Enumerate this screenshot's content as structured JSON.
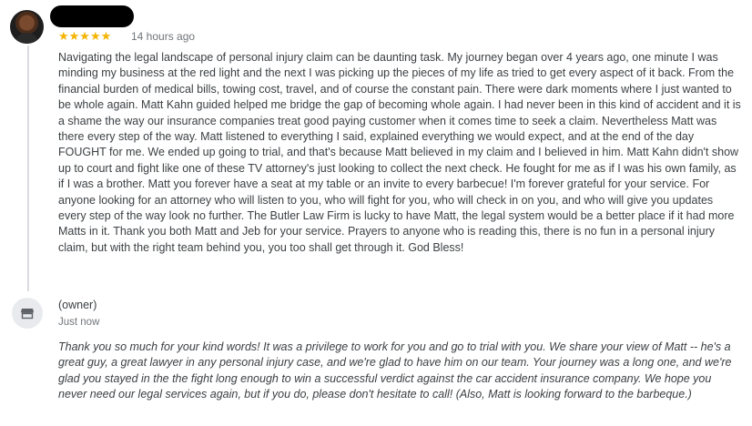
{
  "review": {
    "rating_stars": "★★★★★",
    "time": "14 hours ago",
    "text": "Navigating the legal landscape of personal injury claim can be daunting task. My journey began over 4 years ago, one minute I was minding my business at the red light and the next I was picking up the pieces of my life as tried to get every aspect of it back. From the financial burden of medical bills, towing cost, travel, and of course the constant pain. There were dark moments where I just wanted to be whole again. Matt Kahn guided helped me bridge the gap of becoming whole again. I had never been in this kind of accident and it is a shame the way our insurance companies treat good paying customer when it comes time to seek a claim. Nevertheless Matt was there every step of the way. Matt listened to everything I said, explained everything we would expect, and at the end of the day FOUGHT for me. We ended up going to trial, and that's because Matt believed in my claim and I believed in him. Matt Kahn didn't show up to court and fight like one of these TV attorney's just looking to collect the next check. He fought for me as if I was his own family, as if I was a brother. Matt you forever have a seat at my table or an invite to every barbecue! I'm forever grateful for your service. For anyone looking for an attorney who will listen to you, who will fight for you, who will check in on you, and who will give you updates every step of the way look no further. The Butler Law Firm is lucky to have Matt, the legal system would be a better place if it had more Matts in it. Thank you both Matt and Jeb for your service. Prayers to anyone who is reading this, there is no fun in a personal injury claim, but with the right team behind you, you too shall get through it. God Bless!"
  },
  "owner": {
    "label": "(owner)",
    "time": "Just now",
    "icon": "storefront-icon",
    "reply": "Thank you so much for your kind words! It was a privilege to work for you and go to trial with you. We share your view of Matt -- he's a great guy, a great lawyer in any personal injury case, and we're glad to have him on our team. Your journey was a long one, and we're glad you stayed in the the fight long enough to win a successful verdict against the car accident insurance company. We hope you never need our legal services again, but if you do, please don't hesitate to call! (Also, Matt is looking forward to the barbeque.)"
  },
  "colors": {
    "star": "#f4b400",
    "text": "#3c4043",
    "muted": "#70757a"
  }
}
